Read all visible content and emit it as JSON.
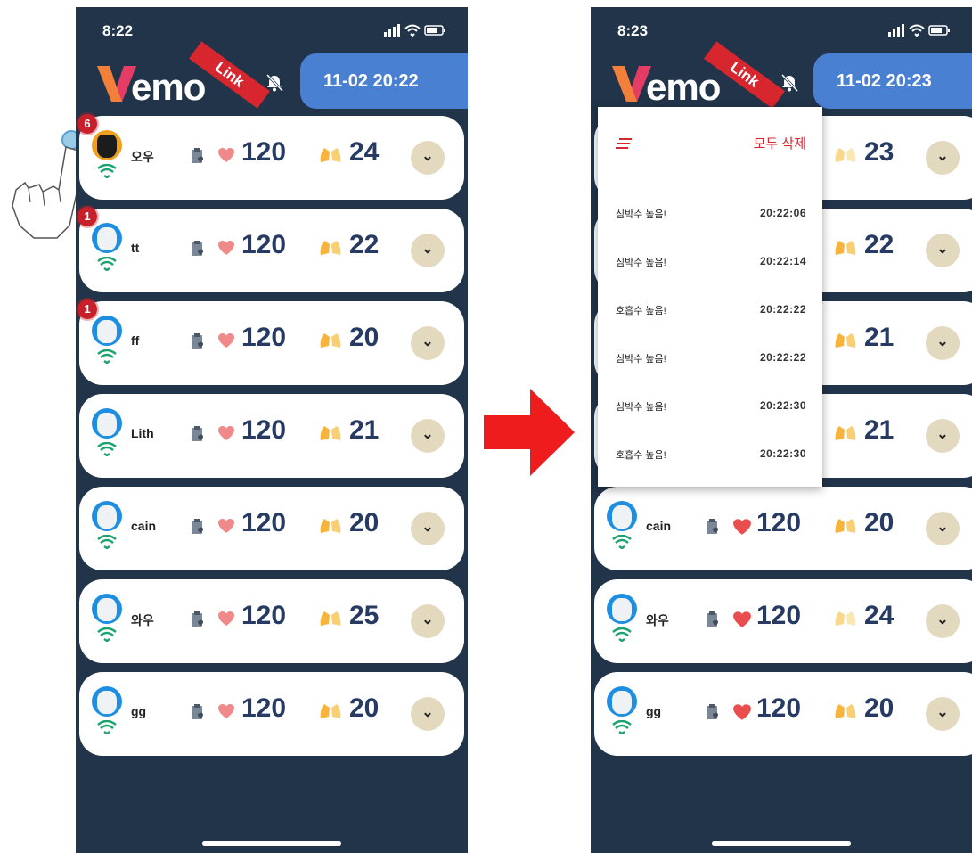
{
  "app": {
    "brand_emo": "emo",
    "brand_link": "Link",
    "colors": {
      "navy": "#22344a",
      "datetime_blue": "#4a80d2",
      "accent_red": "#d7262e",
      "value_blue": "#263a63"
    }
  },
  "left": {
    "time": "8:22",
    "datetime": "11-02 20:22",
    "cards": [
      {
        "name": "오우",
        "badge": "6",
        "hr": "120",
        "rr": "24",
        "avatar": "cat"
      },
      {
        "name": "tt",
        "badge": "1",
        "hr": "120",
        "rr": "22",
        "avatar": "dog"
      },
      {
        "name": "ff",
        "badge": "1",
        "hr": "120",
        "rr": "20",
        "avatar": "dog"
      },
      {
        "name": "Lith",
        "badge": "",
        "hr": "120",
        "rr": "21",
        "avatar": "dog"
      },
      {
        "name": "cain",
        "badge": "",
        "hr": "120",
        "rr": "20",
        "avatar": "dog"
      },
      {
        "name": "와우",
        "badge": "",
        "hr": "120",
        "rr": "25",
        "avatar": "dog"
      },
      {
        "name": "gg",
        "badge": "",
        "hr": "120",
        "rr": "20",
        "avatar": "dog"
      }
    ]
  },
  "right": {
    "time": "8:23",
    "datetime": "11-02 20:23",
    "cards": [
      {
        "name": "",
        "hr": "",
        "rr": "23"
      },
      {
        "name": "",
        "hr": "",
        "rr": "22"
      },
      {
        "name": "",
        "hr": "",
        "rr": "21"
      },
      {
        "name": "",
        "hr": "",
        "rr": "21"
      },
      {
        "name": "cain",
        "hr": "120",
        "rr": "20"
      },
      {
        "name": "와우",
        "hr": "120",
        "rr": "24"
      },
      {
        "name": "gg",
        "hr": "120",
        "rr": "20"
      }
    ],
    "popup": {
      "delete_all": "모두 삭제",
      "notifications": [
        {
          "label": "심박수 높음!",
          "time": "20:22:06"
        },
        {
          "label": "심박수 높음!",
          "time": "20:22:14"
        },
        {
          "label": "호흡수 높음!",
          "time": "20:22:22"
        },
        {
          "label": "심박수 높음!",
          "time": "20:22:22"
        },
        {
          "label": "심박수 높음!",
          "time": "20:22:30"
        },
        {
          "label": "호흡수 높음!",
          "time": "20:22:30"
        }
      ]
    }
  }
}
